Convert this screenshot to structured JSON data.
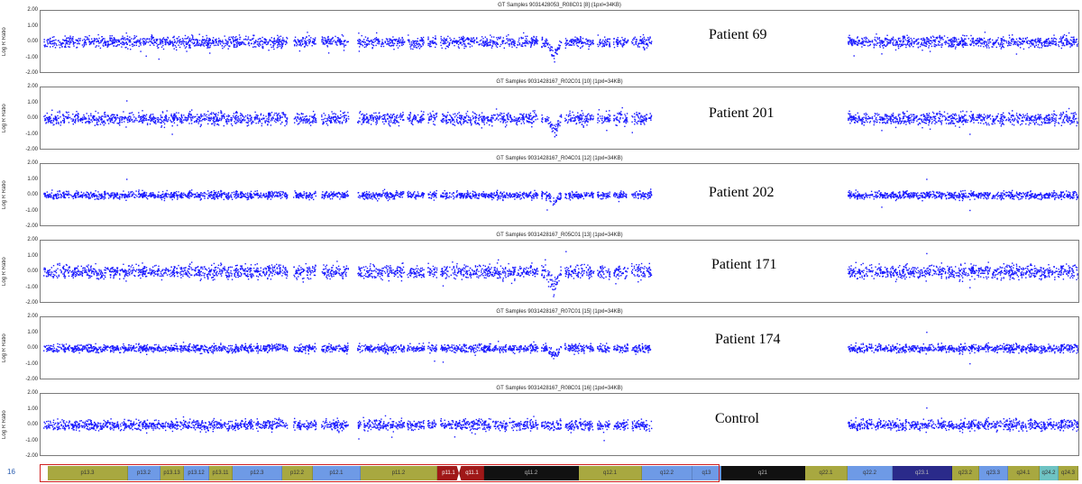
{
  "chart_data": {
    "type": "scatter",
    "ylabel": "Log R Ratio",
    "ylim": [
      -2.0,
      2.0
    ],
    "yticks": [
      "2.00",
      "1.00",
      "0.00",
      "-1.00",
      "-2.00"
    ],
    "panels": [
      {
        "title": "GT Samples 9031428053_R08C01 [8]  (1pxl=34KB)",
        "label": "Patient 69",
        "baseline": 0.0,
        "noise": 0.18,
        "dip_min": -1.2
      },
      {
        "title": "GT Samples 9031428167_R02C01 [10]  (1pxl=34KB)",
        "label": "Patient 201",
        "baseline": 0.0,
        "noise": 0.2,
        "dip_min": -1.1
      },
      {
        "title": "GT Samples 9031428167_R04C01 [12]  (1pxl=34KB)",
        "label": "Patient 202",
        "baseline": 0.0,
        "noise": 0.12,
        "dip_min": -0.6
      },
      {
        "title": "GT Samples 9031428167_R05C01 [13]  (1pxl=34KB)",
        "label": "Patient 171",
        "baseline": 0.0,
        "noise": 0.22,
        "dip_min": -1.3
      },
      {
        "title": "GT Samples 9031428167_R07C01 [15]  (1pxl=34KB)",
        "label": "Patient 174",
        "baseline": 0.0,
        "noise": 0.13,
        "dip_min": -0.6
      },
      {
        "title": "GT Samples 9031428167_R08C01 [16]  (1pxl=34KB)",
        "label": "Control",
        "baseline": 0.0,
        "noise": 0.17,
        "dip_min": 0.0
      }
    ],
    "dot_color": "#1a1aff"
  },
  "ideogram": {
    "chromosome": "16",
    "bands": [
      {
        "name": "p13.3",
        "color": "#a8a840"
      },
      {
        "name": "p13.2",
        "color": "#6e9ae6"
      },
      {
        "name": "p13.13",
        "color": "#a8a840"
      },
      {
        "name": "p13.12",
        "color": "#6e9ae6"
      },
      {
        "name": "p13.11",
        "color": "#a8a840"
      },
      {
        "name": "p12.3",
        "color": "#6e9ae6"
      },
      {
        "name": "p12.2",
        "color": "#a8a840"
      },
      {
        "name": "p12.1",
        "color": "#6e9ae6"
      },
      {
        "name": "p11.2",
        "color": "#a8a840"
      },
      {
        "name": "p11.1",
        "color": "#a01818"
      },
      {
        "name": "q11.1",
        "color": "#a01818"
      },
      {
        "name": "q11.2",
        "color": "#111111"
      },
      {
        "name": "q12.1",
        "color": "#a8a840"
      },
      {
        "name": "q12.2",
        "color": "#6e9ae6"
      },
      {
        "name": "q13",
        "color": "#6e9ae6"
      },
      {
        "name": "q21",
        "color": "#111111"
      },
      {
        "name": "q22.1",
        "color": "#a8a840"
      },
      {
        "name": "q22.2",
        "color": "#6e9ae6"
      },
      {
        "name": "q23.1",
        "color": "#2a2a8a"
      },
      {
        "name": "q23.2",
        "color": "#a8a840"
      },
      {
        "name": "q23.3",
        "color": "#6e9ae6"
      },
      {
        "name": "q24.1",
        "color": "#a8a840"
      },
      {
        "name": "q24.2",
        "color": "#6ec3c3"
      },
      {
        "name": "q24.3",
        "color": "#a8a840"
      }
    ]
  }
}
